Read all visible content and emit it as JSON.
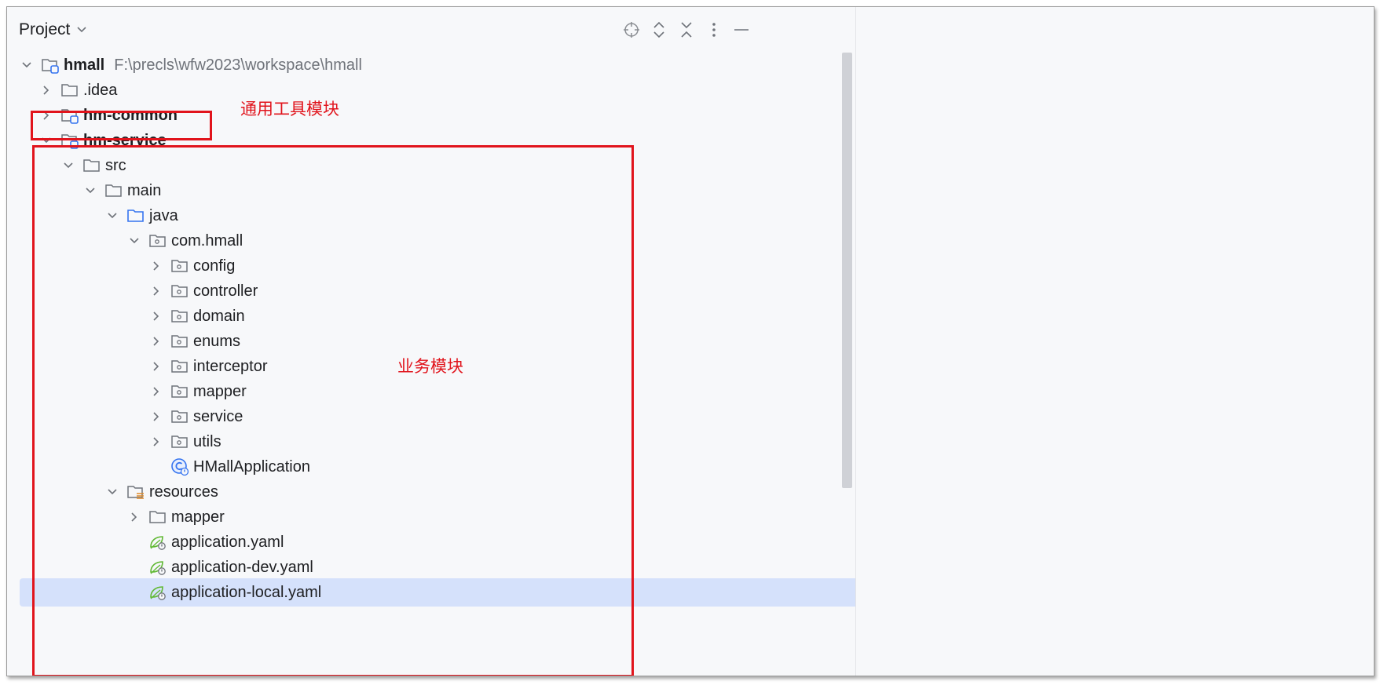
{
  "panel": {
    "title": "Project"
  },
  "tree": {
    "root": {
      "label": "hmall",
      "path": "F:\\precls\\wfw2023\\workspace\\hmall"
    },
    "idea": ".idea",
    "hm_common": "hm-common",
    "hm_service": "hm-service",
    "src": "src",
    "main": "main",
    "java": "java",
    "com_hmall": "com.hmall",
    "config": "config",
    "controller": "controller",
    "domain": "domain",
    "enums": "enums",
    "interceptor": "interceptor",
    "mapper": "mapper",
    "service": "service",
    "utils": "utils",
    "app_class": "HMallApplication",
    "resources": "resources",
    "res_mapper": "mapper",
    "app_yaml": "application.yaml",
    "app_dev_yaml": "application-dev.yaml",
    "app_local_yaml": "application-local.yaml"
  },
  "annotations": {
    "common_label": "通用工具模块",
    "service_label": "业务模块",
    "color": "#e1141c"
  },
  "colors": {
    "selection": "#d5e1fb",
    "module_badge": "#3574f0",
    "source_folder": "#3574f0",
    "spring_leaf": "#5fb832",
    "resources_lines": "#e08b29"
  }
}
